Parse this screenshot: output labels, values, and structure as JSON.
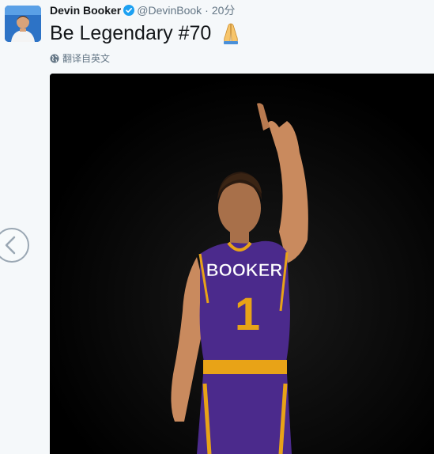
{
  "user": {
    "name": "Devin Booker",
    "handle": "@DevinBook",
    "separator": "·",
    "time": "20分"
  },
  "tweet": {
    "text": "Be Legendary #70"
  },
  "translate": {
    "label": "翻译自英文"
  },
  "media": {
    "jersey_name": "BOOKER",
    "jersey_number": "1"
  },
  "icons": {
    "verified": "verified-badge-icon",
    "emoji": "folded-hands-emoji",
    "translate": "globe-icon",
    "nav": "chevron-left-icon"
  },
  "colors": {
    "verified": "#1da1f2",
    "jersey_purple": "#4b2a8c",
    "jersey_gold": "#e8a317",
    "text_primary": "#14171a",
    "text_secondary": "#657786"
  }
}
